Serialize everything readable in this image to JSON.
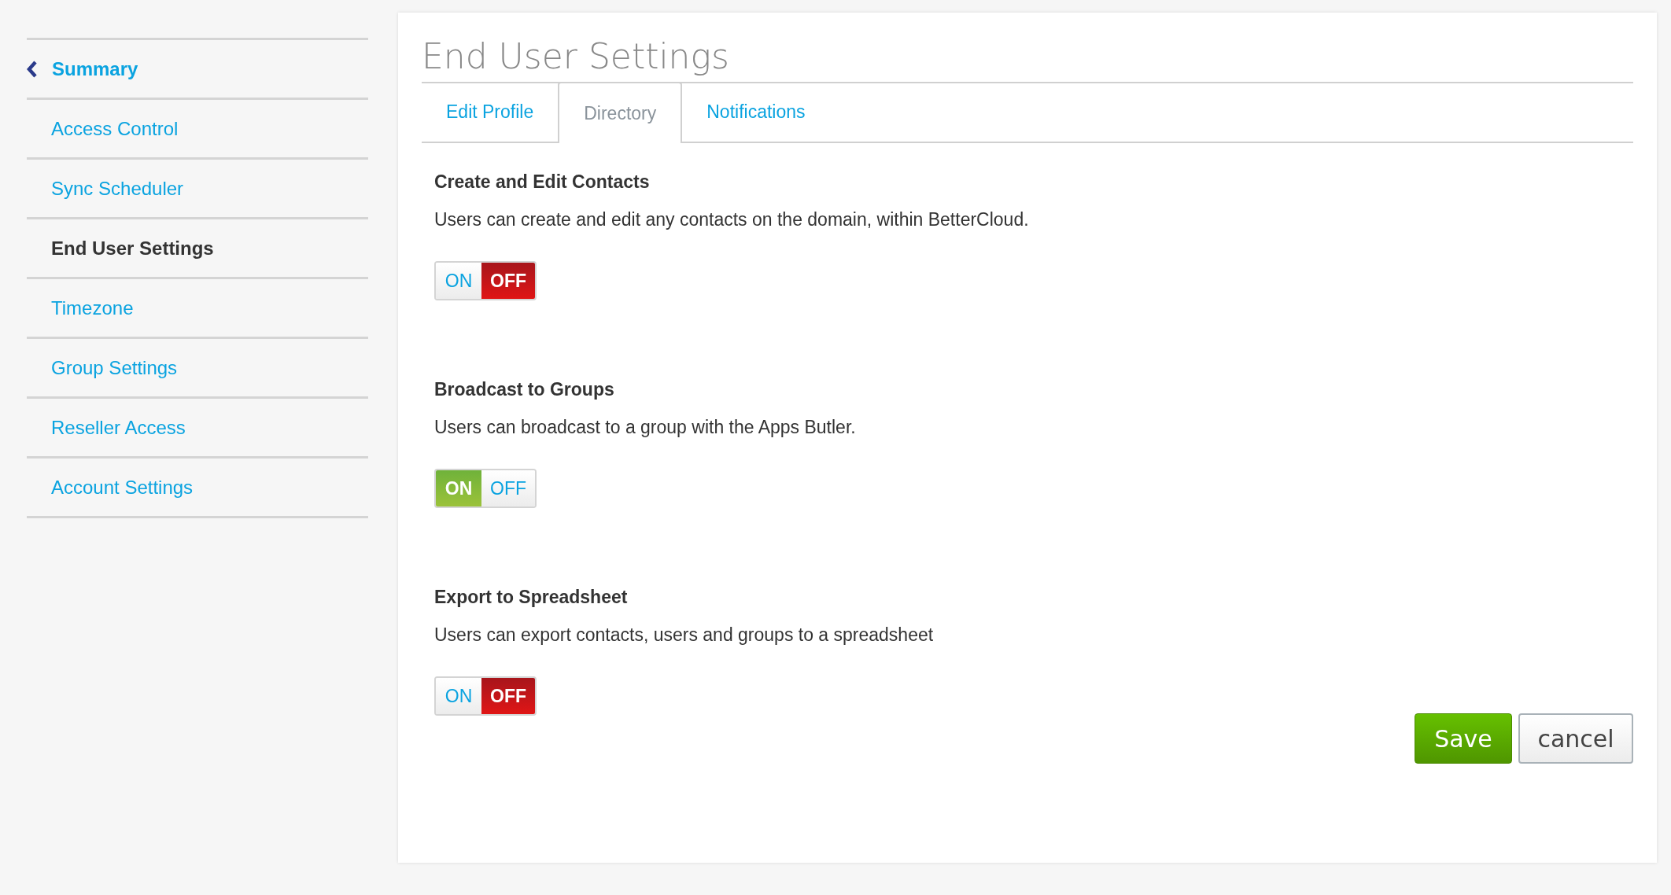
{
  "sidebar": {
    "items": [
      {
        "label": "Summary",
        "kind": "back",
        "selected": false
      },
      {
        "label": "Access Control",
        "kind": "link",
        "selected": false
      },
      {
        "label": "Sync Scheduler",
        "kind": "link",
        "selected": false
      },
      {
        "label": "End User Settings",
        "kind": "link",
        "selected": true
      },
      {
        "label": "Timezone",
        "kind": "link",
        "selected": false
      },
      {
        "label": "Group Settings",
        "kind": "link",
        "selected": false
      },
      {
        "label": "Reseller Access",
        "kind": "link",
        "selected": false
      },
      {
        "label": "Account Settings",
        "kind": "link",
        "selected": false
      }
    ]
  },
  "panel": {
    "title": "End User Settings",
    "tabs": [
      {
        "label": "Edit Profile",
        "selected": false
      },
      {
        "label": "Directory",
        "selected": true
      },
      {
        "label": "Notifications",
        "selected": false
      }
    ],
    "settings": [
      {
        "title": "Create and Edit Contacts",
        "description": "Users can create and edit any contacts on the domain, within BetterCloud.",
        "on_label": "ON",
        "off_label": "OFF",
        "on": false
      },
      {
        "title": "Broadcast to Groups",
        "description": "Users can broadcast to a group with the Apps Butler.",
        "on_label": "ON",
        "off_label": "OFF",
        "on": true
      },
      {
        "title": "Export to Spreadsheet",
        "description": "Users can export contacts, users and groups to a spreadsheet",
        "on_label": "ON",
        "off_label": "OFF",
        "on": false
      }
    ],
    "buttons": {
      "save": "Save",
      "cancel": "cancel"
    }
  }
}
